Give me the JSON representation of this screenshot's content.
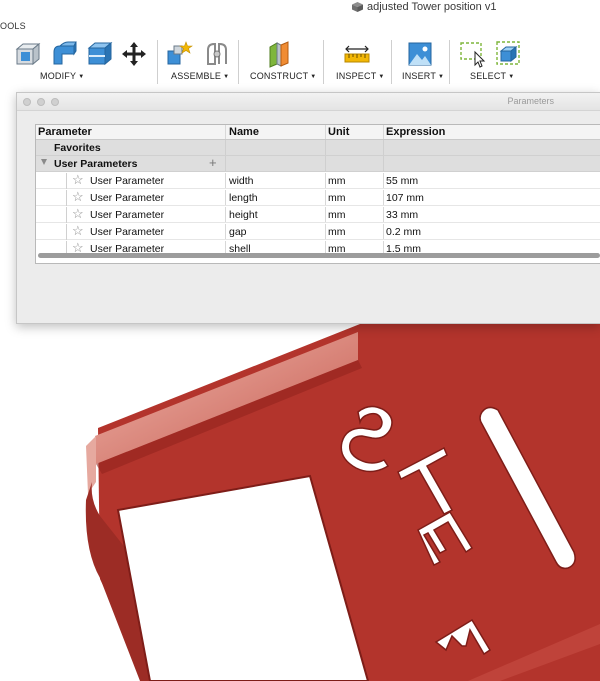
{
  "window": {
    "document_title": "adjusted Tower position v1"
  },
  "toolbar": {
    "tools_label": "OOLS",
    "groups": [
      {
        "label": "MODIFY"
      },
      {
        "label": "ASSEMBLE"
      },
      {
        "label": "CONSTRUCT"
      },
      {
        "label": "INSPECT"
      },
      {
        "label": "INSERT"
      },
      {
        "label": "SELECT"
      }
    ],
    "icons": [
      "press-pull-icon",
      "fillet-icon",
      "shell-icon",
      "move-icon",
      "new-component-icon",
      "joint-icon",
      "offset-plane-icon",
      "measure-icon",
      "insert-image-icon",
      "select-window-icon",
      "select-box-icon"
    ]
  },
  "parameters_dialog": {
    "title": "Parameters",
    "columns": {
      "parameter": "Parameter",
      "name": "Name",
      "unit": "Unit",
      "expression": "Expression"
    },
    "favorites_label": "Favorites",
    "user_parameters_label": "User Parameters",
    "add_symbol": "+",
    "rows": [
      {
        "parameter": "User Parameter",
        "name": "width",
        "unit": "mm",
        "expression": "55 mm"
      },
      {
        "parameter": "User Parameter",
        "name": "length",
        "unit": "mm",
        "expression": "107 mm"
      },
      {
        "parameter": "User Parameter",
        "name": "height",
        "unit": "mm",
        "expression": "33 mm"
      },
      {
        "parameter": "User Parameter",
        "name": "gap",
        "unit": "mm",
        "expression": "0.2 mm"
      },
      {
        "parameter": "User Parameter",
        "name": "shell",
        "unit": "mm",
        "expression": "1.5 mm"
      }
    ]
  },
  "viewport": {
    "model_color": "#b3342c",
    "model_highlight": "#e8a399",
    "embossed_text": "STEM"
  }
}
